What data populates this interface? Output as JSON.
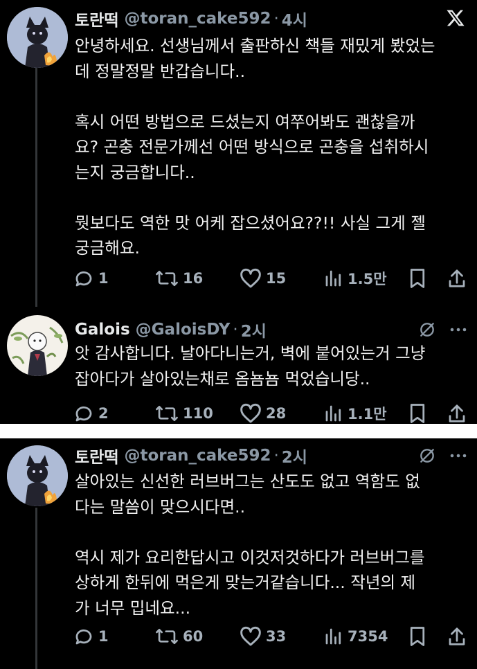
{
  "colors": {
    "background": "#000000",
    "text": "#e7e9ea",
    "muted": "#8b98a5",
    "line": "#333639"
  },
  "tweets": [
    {
      "name": "토란떡",
      "handle": "@toran_cake592",
      "separator": "·",
      "time": "4시",
      "paragraphs": [
        "안녕하세요. 선생님께서 출판하신 책들 재밌게 봤었는데 정말정말 반갑습니다..",
        "혹시 어떤 방법으로 드셨는지 여쭈어봐도 괜찮을까요? 곤충 전문가께선 어떤 방식으로 곤충을 섭취하시는지 궁금합니다..",
        "뭣보다도 역한 맛 어케 잡으셨어요??!! 사실 그게 젤 궁금해요."
      ],
      "lines": [
        [
          "안녕하세요. 선생님께서 출판하신 책들 재밌게 봤었는",
          "데 정말정말 반갑습니다.."
        ],
        [
          "혹시 어떤 방법으로 드셨는지 여쭈어봐도 괜찮을까",
          "요? 곤충 전문가께선 어떤 방식으로 곤충을 섭취하시",
          "는지 궁금합니다.."
        ],
        [
          "뭣보다도 역한 맛 어케 잡으셨어요??!! 사실 그게 젤",
          "궁금해요."
        ]
      ],
      "replies": "1",
      "reposts": "16",
      "likes": "15",
      "views": "1.5만",
      "top_icon": "x-logo-icon"
    },
    {
      "name": "Galois",
      "handle": "@GaloisDY",
      "separator": "·",
      "time": "2시",
      "lines": [
        [
          "앗 감사합니다. 날아다니는거, 벽에 붙어있는거 그냥",
          "잡아다가 살아있는채로 옴뇸뇸 먹었습니당.."
        ]
      ],
      "replies": "2",
      "reposts": "110",
      "likes": "28",
      "views": "1.1만",
      "top_icon": "grok-icon"
    },
    {
      "name": "토란떡",
      "handle": "@toran_cake592",
      "separator": "·",
      "time": "2시",
      "lines": [
        [
          "살아있는 신선한 러브버그는 산도도 없고 역함도 없",
          "다는 말씀이 맞으시다면.."
        ],
        [
          "역시 제가 요리한답시고 이것저것하다가 러브버그를",
          "상하게 한뒤에 먹은게 맞는거같습니다... 작년의 제",
          "가 너무 밉네요..."
        ]
      ],
      "replies": "1",
      "reposts": "60",
      "likes": "33",
      "views": "7354",
      "top_icon": "grok-icon"
    }
  ]
}
